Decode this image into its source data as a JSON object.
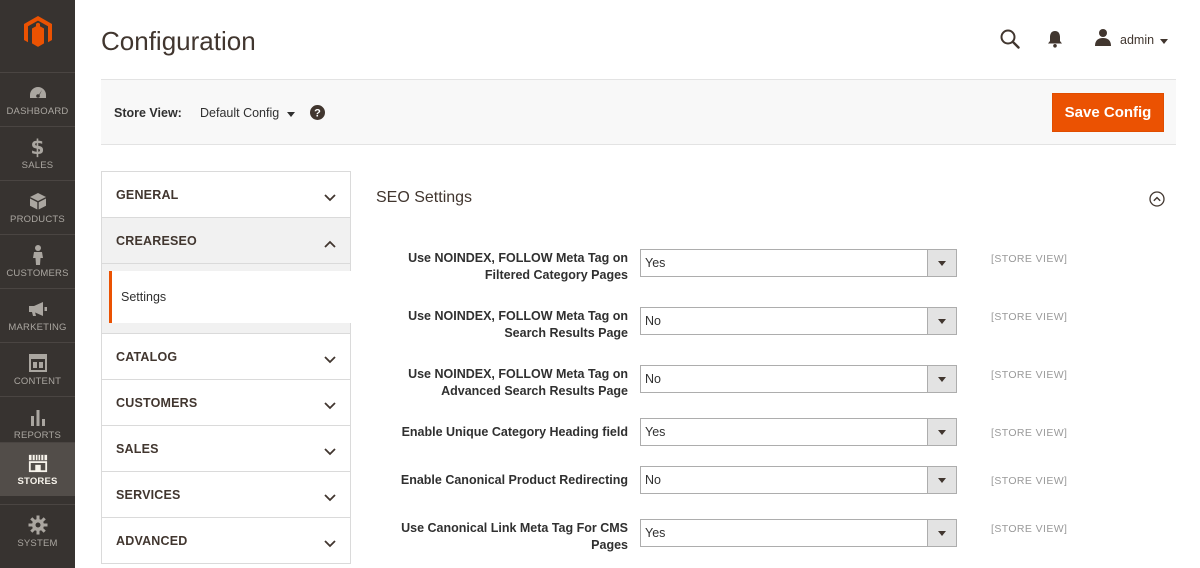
{
  "nav": {
    "items": [
      {
        "label": "DASHBOARD",
        "icon": "dashboard-icon"
      },
      {
        "label": "SALES",
        "icon": "dollar-icon"
      },
      {
        "label": "PRODUCTS",
        "icon": "box-icon"
      },
      {
        "label": "CUSTOMERS",
        "icon": "person-icon"
      },
      {
        "label": "MARKETING",
        "icon": "megaphone-icon"
      },
      {
        "label": "CONTENT",
        "icon": "layout-icon"
      },
      {
        "label": "REPORTS",
        "icon": "bar-chart-icon"
      },
      {
        "label": "STORES",
        "icon": "storefront-icon"
      },
      {
        "label": "SYSTEM",
        "icon": "gear-icon"
      }
    ],
    "active": "STORES"
  },
  "header": {
    "title": "Configuration",
    "user": "admin"
  },
  "toolbar": {
    "store_view_label": "Store View:",
    "store_view_value": "Default Config",
    "save_label": "Save Config"
  },
  "tabs": {
    "general": "GENERAL",
    "creareseo": "CREARESEO",
    "settings": "Settings",
    "catalog": "CATALOG",
    "customers": "CUSTOMERS",
    "sales": "SALES",
    "services": "SERVICES",
    "advanced": "ADVANCED"
  },
  "section": {
    "title": "SEO Settings",
    "rows": [
      {
        "label_line1": "Use NOINDEX, FOLLOW Meta Tag on",
        "label_line2": "Filtered Category Pages",
        "value": "Yes",
        "scope": "[STORE VIEW]"
      },
      {
        "label_line1": "Use NOINDEX, FOLLOW Meta Tag on",
        "label_line2": "Search Results Page",
        "value": "No",
        "scope": "[STORE VIEW]"
      },
      {
        "label_line1": "Use NOINDEX, FOLLOW Meta Tag on",
        "label_line2": "Advanced Search Results Page",
        "value": "No",
        "scope": "[STORE VIEW]"
      },
      {
        "label_line1": "Enable Unique Category Heading field",
        "label_line2": "",
        "value": "Yes",
        "scope": "[STORE VIEW]"
      },
      {
        "label_line1": "Enable Canonical Product Redirecting",
        "label_line2": "",
        "value": "No",
        "scope": "[STORE VIEW]"
      },
      {
        "label_line1": "Use Canonical Link Meta Tag For CMS",
        "label_line2": "Pages",
        "value": "Yes",
        "scope": "[STORE VIEW]"
      }
    ]
  },
  "colors": {
    "accent": "#eb5202",
    "sidebar": "#373330",
    "sidebar_active": "#524d49"
  }
}
